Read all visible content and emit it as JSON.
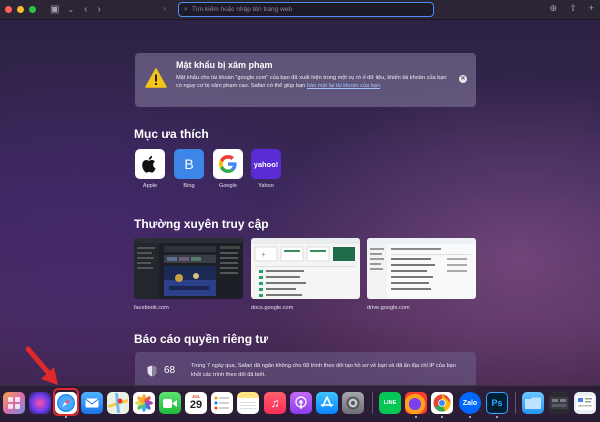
{
  "browser": {
    "address_placeholder": "Tìm kiếm hoặc nhập tên trang web"
  },
  "warning": {
    "title": "Mật khẩu bị xâm phạm",
    "body": "Mật khẩu cho tài khoản \"google.com\" của bạn đã xuất hiện trong một vụ rò rỉ dữ liệu, khiến tài khoản của bạn có nguy cơ bị xâm phạm cao. Safari có thể giúp bạn ",
    "link": "bảo mật lại tài khoản của bạn",
    "link_end": "."
  },
  "favorites": {
    "title": "Mục ưa thích",
    "items": [
      {
        "label": "Apple",
        "tile_text": "",
        "bg": "#ffffff"
      },
      {
        "label": "Bing",
        "tile_text": "B",
        "bg": "#3d86e8"
      },
      {
        "label": "Google",
        "tile_text": "G",
        "bg": "#ffffff"
      },
      {
        "label": "Yahoo",
        "tile_text": "yahoo!",
        "bg": "#5b2bd6"
      }
    ]
  },
  "frequent": {
    "title": "Thường xuyên truy cập",
    "items": [
      {
        "label": "facebook.com"
      },
      {
        "label": "docs.google.com"
      },
      {
        "label": "drive.google.com"
      }
    ]
  },
  "privacy": {
    "title": "Báo cáo quyền riêng tư",
    "count": "68",
    "text": "Trong 7 ngày qua, Safari đã ngăn không cho 68 trình theo dõi tạo hồ sơ về bạn và đã ẩn địa chỉ IP của bạn khỏi các trình theo dõi đã biết."
  },
  "dock": {
    "calendar_month": "JUL",
    "calendar_day": "29",
    "zalo_label": "Zalo",
    "ps_label": "Ps",
    "line_label": "LINE"
  },
  "colors": {
    "accent_blue": "#4d8df7",
    "highlight_red": "#e0292a"
  }
}
